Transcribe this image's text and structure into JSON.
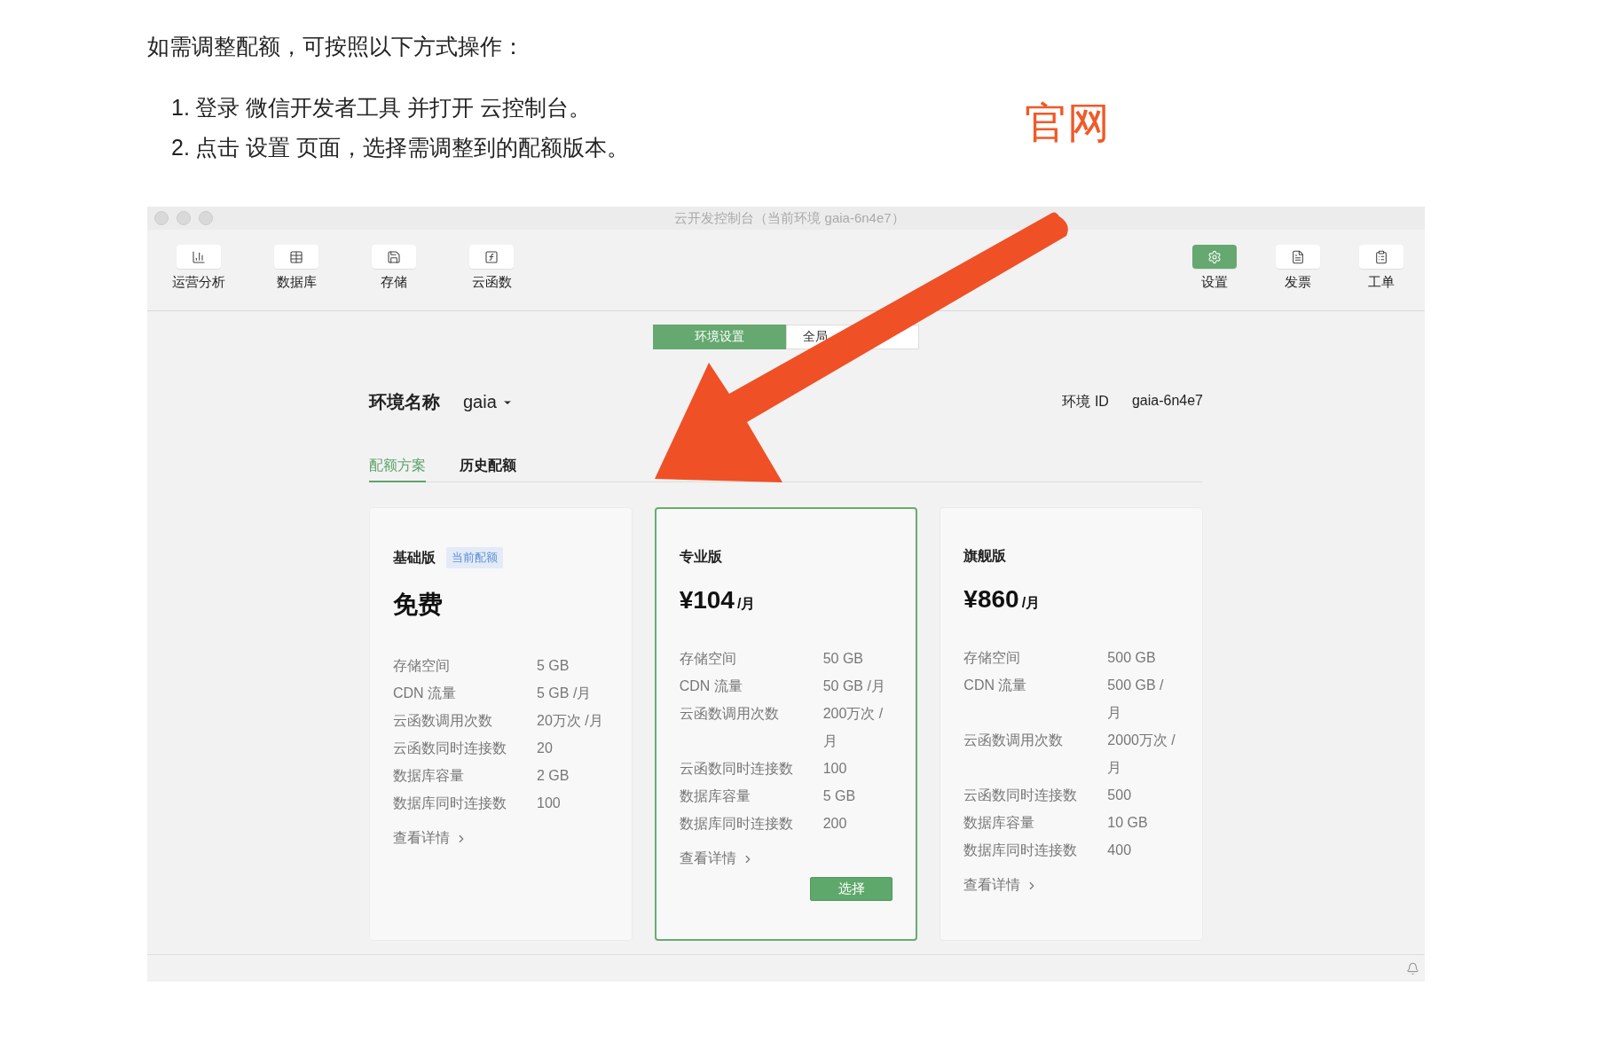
{
  "doc": {
    "intro": "如需调整配额，可按照以下方式操作：",
    "steps": [
      {
        "marker": "1.",
        "text": "登录 微信开发者工具 并打开 云控制台。"
      },
      {
        "marker": "2.",
        "text": "点击 设置 页面，选择需调整到的配额版本。"
      }
    ],
    "annotation": "官网"
  },
  "window": {
    "title": "云开发控制台（当前环境 gaia-6n4e7）"
  },
  "toolbar": {
    "left": [
      {
        "label": "运营分析",
        "selected": false
      },
      {
        "label": "数据库",
        "selected": false
      },
      {
        "label": "存储",
        "selected": false
      },
      {
        "label": "云函数",
        "selected": false
      }
    ],
    "right": [
      {
        "label": "设置",
        "selected": true
      },
      {
        "label": "发票",
        "selected": false
      },
      {
        "label": "工单",
        "selected": false
      }
    ]
  },
  "segments": [
    {
      "label": "环境设置",
      "selected": true
    },
    {
      "label": "全局",
      "selected": false
    }
  ],
  "env": {
    "name_label": "环境名称",
    "name": "gaia",
    "id_label": "环境 ID",
    "id": "gaia-6n4e7"
  },
  "tabs": [
    {
      "label": "配额方案",
      "selected": true
    },
    {
      "label": "历史配额",
      "selected": false
    }
  ],
  "plans": [
    {
      "title": "基础版",
      "badge": "当前配额",
      "price": "免费",
      "selected": false,
      "specs": [
        {
          "label": "存储空间",
          "value": "5 GB"
        },
        {
          "label": "CDN 流量",
          "value": "5 GB /月"
        },
        {
          "label": "云函数调用次数",
          "value": "20万次 /月"
        },
        {
          "label": "云函数同时连接数",
          "value": "20"
        },
        {
          "label": "数据库容量",
          "value": "2 GB"
        },
        {
          "label": "数据库同时连接数",
          "value": "100"
        }
      ],
      "details": "查看详情"
    },
    {
      "title": "专业版",
      "price": "¥104",
      "unit": "/月",
      "selected": true,
      "specs": [
        {
          "label": "存储空间",
          "value": "50 GB"
        },
        {
          "label": "CDN 流量",
          "value": "50 GB /月"
        },
        {
          "label": "云函数调用次数",
          "value": "200万次 /月"
        },
        {
          "label": "云函数同时连接数",
          "value": "100"
        },
        {
          "label": "数据库容量",
          "value": "5 GB"
        },
        {
          "label": "数据库同时连接数",
          "value": "200"
        }
      ],
      "details": "查看详情",
      "button": "选择"
    },
    {
      "title": "旗舰版",
      "price": "¥860",
      "unit": "/月",
      "selected": false,
      "specs": [
        {
          "label": "存储空间",
          "value": "500 GB"
        },
        {
          "label": "CDN 流量",
          "value": "500 GB /月"
        },
        {
          "label": "云函数调用次数",
          "value": "2000万次 /月"
        },
        {
          "label": "云函数同时连接数",
          "value": "500"
        },
        {
          "label": "数据库容量",
          "value": "10 GB"
        },
        {
          "label": "数据库同时连接数",
          "value": "400"
        }
      ],
      "details": "查看详情"
    }
  ]
}
